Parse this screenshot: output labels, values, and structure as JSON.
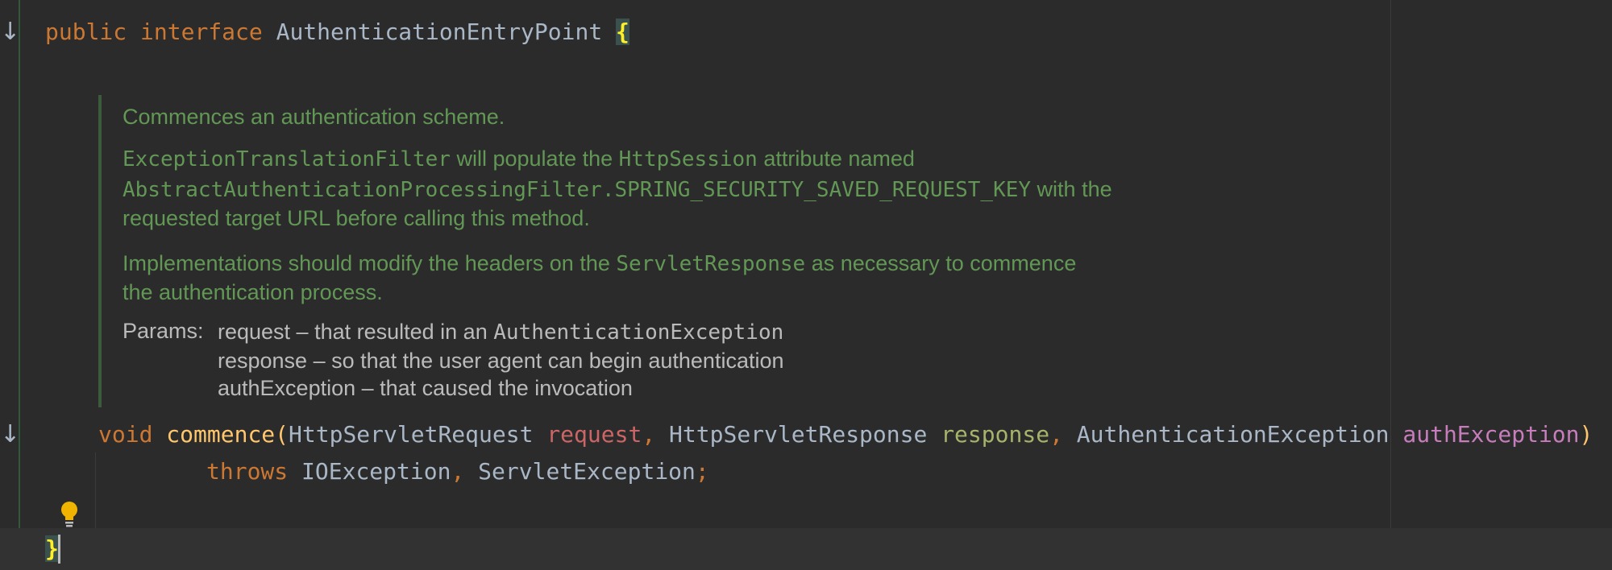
{
  "editor": {
    "line_interface": {
      "kw_public": "public",
      "kw_interface": "interface",
      "name": "AuthenticationEntryPoint",
      "open_brace": "{"
    },
    "javadoc": {
      "summary": "Commences an authentication scheme.",
      "p2_code1": "ExceptionTranslationFilter",
      "p2_text1": " will populate the ",
      "p2_code2": "HttpSession",
      "p2_text2": " attribute named",
      "p2_code3": "AbstractAuthenticationProcessingFilter.SPRING_SECURITY_SAVED_REQUEST_KEY",
      "p2_text3": " with the",
      "p2_text4": "requested target URL before calling this method.",
      "p3_text1": "Implementations should modify the headers on the ",
      "p3_code1": "ServletResponse",
      "p3_text2": " as necessary to commence",
      "p3_text3": "the authentication process.",
      "params_label": "Params:",
      "param1_text": "request – that resulted in an ",
      "param1_code": "AuthenticationException",
      "param2_text": "response – so that the user agent can begin authentication",
      "param3_text": "authException – that caused the invocation"
    },
    "method": {
      "kw_void": "void",
      "name": "commence",
      "open_paren": "(",
      "type1": "HttpServletRequest",
      "arg1": "request",
      "comma1": ",",
      "type2": "HttpServletResponse",
      "arg2": "response",
      "comma2": ",",
      "type3": "AuthenticationException",
      "arg3": "authException",
      "close_paren": ")",
      "kw_throws": "throws",
      "exc1": "IOException",
      "comma3": ",",
      "exc2": "ServletException",
      "semicolon": ";"
    },
    "close_brace": "}",
    "gutter": {
      "impl_marker_1": "↓",
      "impl_marker_2": "↓"
    },
    "colors": {
      "background": "#2b2b2b",
      "keyword": "#cc7832",
      "method_name": "#ffc66d",
      "javadoc": "#629755",
      "brace_highlight": "#ffef28"
    },
    "icons": [
      "implementation-arrow-icon",
      "lightbulb-icon"
    ]
  }
}
